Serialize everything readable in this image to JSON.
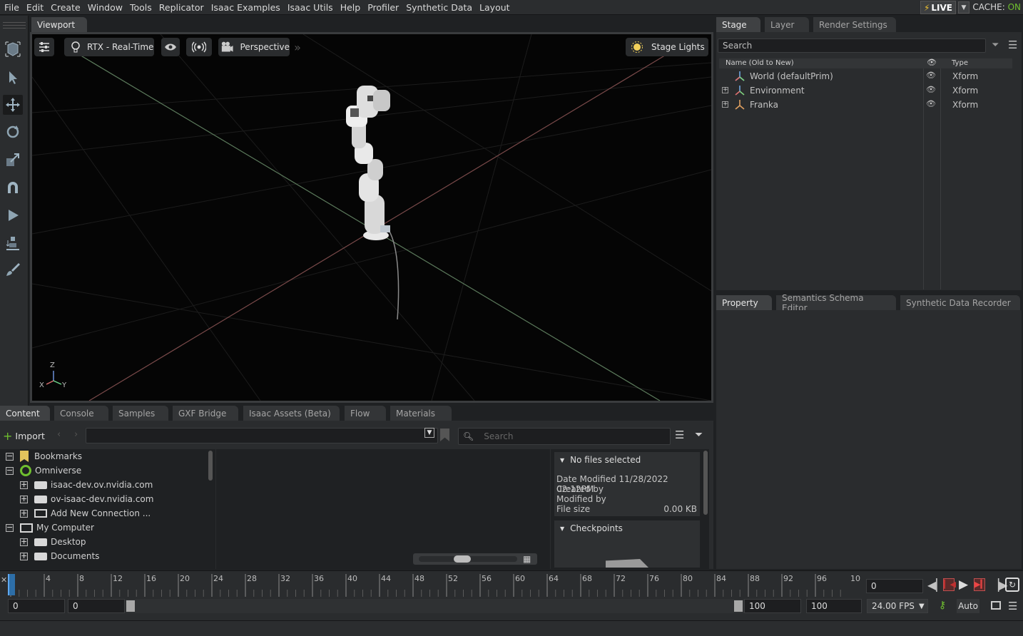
{
  "menu": [
    "File",
    "Edit",
    "Create",
    "Window",
    "Tools",
    "Replicator",
    "Isaac Examples",
    "Isaac Utils",
    "Help",
    "Profiler",
    "Synthetic Data",
    "Layout"
  ],
  "live": {
    "label": "LIVE",
    "cache_label": "CACHE:",
    "cache_state": "ON"
  },
  "viewport": {
    "tab": "Viewport",
    "renderer": "RTX - Real-Time",
    "camera": "Perspective",
    "lights": "Stage Lights",
    "axes": {
      "z": "Z",
      "x": "X",
      "y": "Y"
    }
  },
  "stage": {
    "tabs": [
      "Stage",
      "Layer",
      "Render Settings"
    ],
    "search_placeholder": "Search",
    "columns": {
      "name": "Name (Old to New)",
      "type": "Type"
    },
    "rows": [
      {
        "name": "World (defaultPrim)",
        "type": "Xform"
      },
      {
        "name": "Environment",
        "type": "Xform"
      },
      {
        "name": "Franka",
        "type": "Xform"
      }
    ]
  },
  "property": {
    "tabs": [
      "Property",
      "Semantics Schema Editor",
      "Synthetic Data Recorder"
    ]
  },
  "content": {
    "tabs": [
      "Content",
      "Console",
      "Samples",
      "GXF Bridge",
      "Isaac Assets (Beta)",
      "Flow",
      "Materials"
    ],
    "import_label": "Import",
    "search_placeholder": "Search",
    "tree": [
      {
        "label": "Bookmarks"
      },
      {
        "label": "Omniverse"
      },
      {
        "label": "isaac-dev.ov.nvidia.com"
      },
      {
        "label": "ov-isaac-dev.nvidia.com"
      },
      {
        "label": "Add New Connection ..."
      },
      {
        "label": "My Computer"
      },
      {
        "label": "Desktop"
      },
      {
        "label": "Documents"
      }
    ],
    "info": {
      "header": "No files selected",
      "date_modified_label": "Date Modified",
      "date_modified": "11/28/2022 02:12PM",
      "created_by_label": "Created by",
      "modified_by_label": "Modified by",
      "file_size_label": "File size",
      "file_size": "0.00 KB",
      "checkpoints": "Checkpoints"
    }
  },
  "timeline": {
    "ticks": [
      "4",
      "8",
      "12",
      "16",
      "20",
      "24",
      "28",
      "32",
      "36",
      "40",
      "44",
      "48",
      "52",
      "56",
      "60",
      "64",
      "68",
      "72",
      "76",
      "80",
      "84",
      "88",
      "92",
      "96",
      "10"
    ],
    "current_frame": "0",
    "start": "0",
    "range_start": "0",
    "range_end": "100",
    "end": "100",
    "fps": "24.00 FPS",
    "auto": "Auto"
  },
  "colors": {
    "accent_green": "#6fbf2f",
    "live_bolt": "#f4c430"
  }
}
